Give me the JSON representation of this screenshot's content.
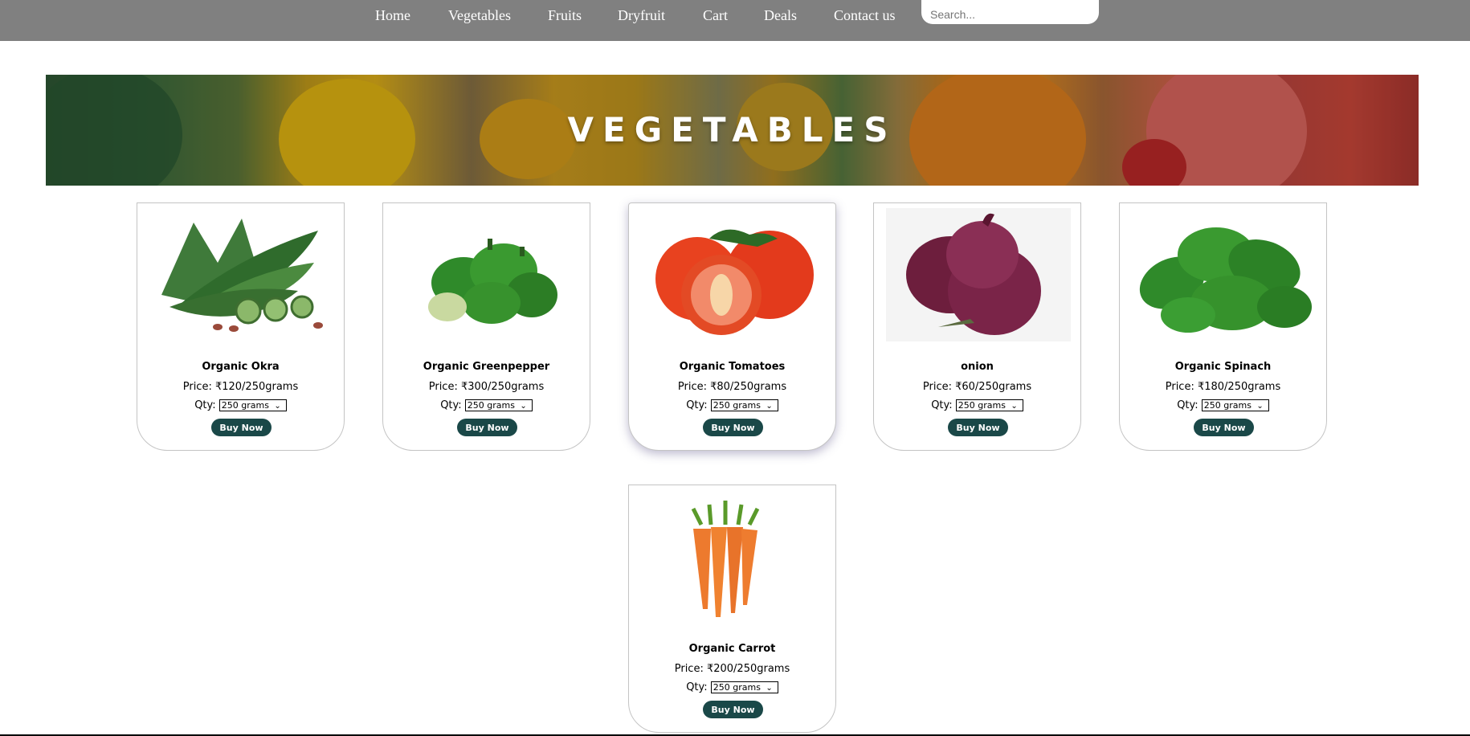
{
  "nav": {
    "items": [
      {
        "label": "Home"
      },
      {
        "label": "Vegetables"
      },
      {
        "label": "Fruits"
      },
      {
        "label": "Dryfruit"
      },
      {
        "label": "Cart"
      },
      {
        "label": "Deals"
      },
      {
        "label": "Contact us"
      }
    ],
    "search_placeholder": "Search..."
  },
  "banner": {
    "title": "VEGETABLES"
  },
  "products": [
    {
      "name": "Organic Okra",
      "price": "Price: ₹120/250grams",
      "qty_label": "Qty:",
      "qty_selected": "250 grams",
      "button": "Buy Now",
      "image": "okra"
    },
    {
      "name": "Organic Greenpepper",
      "price": "Price: ₹300/250grams",
      "qty_label": "Qty:",
      "qty_selected": "250 grams",
      "button": "Buy Now",
      "image": "green-pepper"
    },
    {
      "name": "Organic Tomatoes",
      "price": "Price: ₹80/250grams",
      "qty_label": "Qty:",
      "qty_selected": "250 grams",
      "button": "Buy Now",
      "image": "tomatoes"
    },
    {
      "name": "onion",
      "price": "Price: ₹60/250grams",
      "qty_label": "Qty:",
      "qty_selected": "250 grams",
      "button": "Buy Now",
      "image": "red-onion"
    },
    {
      "name": "Organic Spinach",
      "price": "Price: ₹180/250grams",
      "qty_label": "Qty:",
      "qty_selected": "250 grams",
      "button": "Buy Now",
      "image": "spinach"
    },
    {
      "name": "Organic Carrot",
      "price": "Price: ₹200/250grams",
      "qty_label": "Qty:",
      "qty_selected": "250 grams",
      "button": "Buy Now",
      "image": "carrots"
    }
  ],
  "colors": {
    "navbar": "#808080",
    "button": "#1a4848",
    "card_border": "#c4c4c4"
  }
}
